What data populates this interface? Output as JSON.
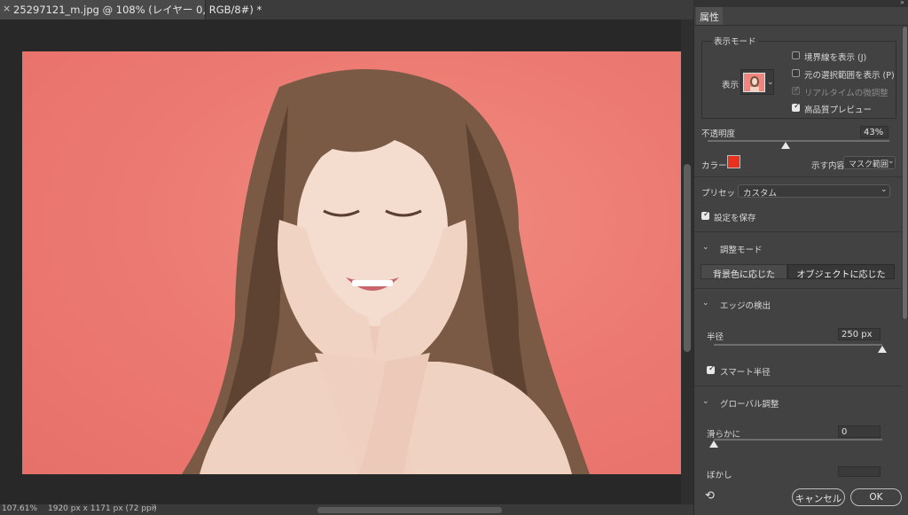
{
  "document": {
    "tab_close_icon": "close-icon",
    "tab_title": "25297121_m.jpg @ 108% (レイヤー 0, RGB/8#) *",
    "zoom": "107.61%",
    "dimensions": "1920 px x 1171 px (72 ppi)",
    "status_arrow": "›"
  },
  "panel": {
    "tab_label": "属性",
    "view_mode": {
      "group_label": "表示モード",
      "view_label": "表示",
      "options": [
        {
          "label": "境界線を表示 (J)",
          "checked": false,
          "enabled": true
        },
        {
          "label": "元の選択範囲を表示 (P)",
          "checked": false,
          "enabled": true
        },
        {
          "label": "リアルタイムの微調整",
          "checked": true,
          "enabled": false
        },
        {
          "label": "高品質プレビュー",
          "checked": true,
          "enabled": true
        }
      ]
    },
    "opacity": {
      "label": "不透明度",
      "value": "43%",
      "level": 0.43
    },
    "color": {
      "label": "カラー",
      "swatch": "#e8301e"
    },
    "show_content": {
      "label": "示す内容",
      "value": "マスク範囲"
    },
    "preset": {
      "label": "プリセット",
      "value": "カスタム"
    },
    "save_settings": {
      "label": "設定を保存",
      "checked": true
    },
    "adjust_mode": {
      "title": "調整モード",
      "options": [
        "背景色に応じた",
        "オブジェクトに応じた"
      ],
      "selected": 1
    },
    "edge_detection": {
      "title": "エッジの検出",
      "radius_label": "半径",
      "radius_value": "250 px",
      "radius_level": 1.0,
      "smart_radius": {
        "label": "スマート半径",
        "checked": true
      }
    },
    "global_adjust": {
      "title": "グローバル調整",
      "smooth_label": "滑らかに",
      "smooth_value": "0",
      "smooth_level": 0.0,
      "feather_label": "ぼかし"
    },
    "reset_icon": "reset-icon",
    "cancel_label": "キャンセル",
    "ok_label": "OK"
  }
}
